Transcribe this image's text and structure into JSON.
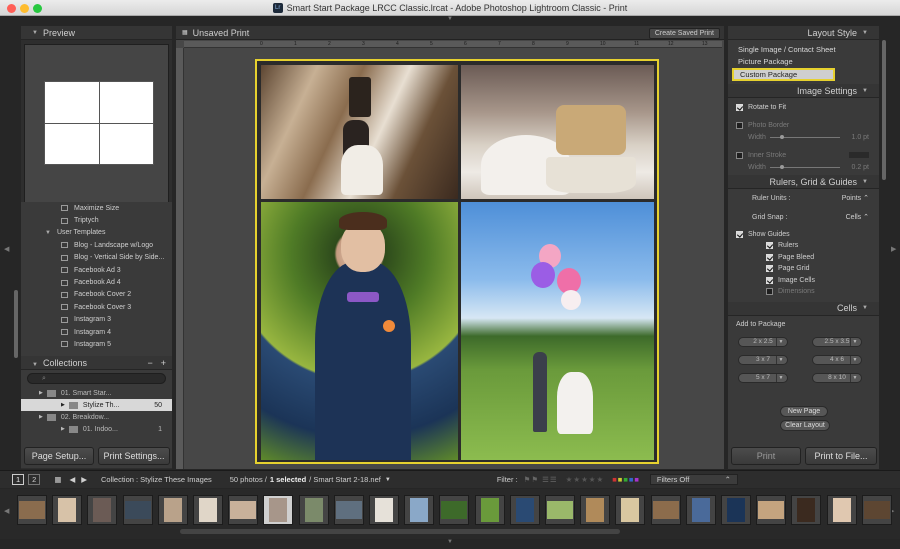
{
  "window": {
    "title": "Smart Start Package LRCC Classic.lrcat - Adobe Photoshop Lightroom Classic - Print",
    "app_badge": "Lr"
  },
  "left": {
    "preview_title": "Preview",
    "template_items": [
      {
        "label": "Maximize Size",
        "folder": false
      },
      {
        "label": "Triptych",
        "folder": false
      },
      {
        "label": "User Templates",
        "folder": true
      },
      {
        "label": "Blog - Landscape w/Logo",
        "folder": false
      },
      {
        "label": "Blog - Vertical Side by Side...",
        "folder": false
      },
      {
        "label": "Facebook Ad 3",
        "folder": false
      },
      {
        "label": "Facebook Ad 4",
        "folder": false
      },
      {
        "label": "Facebook Cover 2",
        "folder": false
      },
      {
        "label": "Facebook Cover 3",
        "folder": false
      },
      {
        "label": "Instagram 3",
        "folder": false
      },
      {
        "label": "Instagram 4",
        "folder": false
      },
      {
        "label": "Instagram 5",
        "folder": false
      }
    ],
    "collections_title": "Collections",
    "collections_minus": "−",
    "collections_plus": "+",
    "collections": [
      {
        "label": "01. Smart Star...",
        "count": "",
        "selected": false,
        "indent": 18
      },
      {
        "label": "Stylize Th...",
        "count": "50",
        "selected": true,
        "indent": 40
      },
      {
        "label": "02. Breakdow...",
        "count": "",
        "selected": false,
        "indent": 18
      },
      {
        "label": "01. Indoo...",
        "count": "1",
        "selected": false,
        "indent": 40
      }
    ],
    "page_setup": "Page Setup...",
    "print_settings": "Print Settings..."
  },
  "center": {
    "title": "Unsaved Print",
    "create_saved": "Create Saved Print",
    "ruler_ticks": [
      "0",
      "1",
      "2",
      "3",
      "4",
      "5",
      "6",
      "7",
      "8",
      "9",
      "10",
      "11",
      "12",
      "13",
      "14",
      "15",
      "16"
    ]
  },
  "right": {
    "layout_style": "Layout Style",
    "layout_options": [
      "Single Image / Contact Sheet",
      "Picture Package",
      "Custom Package"
    ],
    "image_settings": "Image Settings",
    "rotate_to_fit": "Rotate to Fit",
    "photo_border": "Photo Border",
    "width_label": "Width",
    "border_val": "1.0 pt",
    "inner_stroke": "Inner Stroke",
    "stroke_val": "0.2 pt",
    "rulers_title": "Rulers, Grid & Guides",
    "ruler_units_label": "Ruler Units :",
    "ruler_units_val": "Points",
    "grid_snap_label": "Grid Snap :",
    "grid_snap_val": "Cells",
    "show_guides": "Show Guides",
    "guides": [
      {
        "label": "Rulers",
        "on": true
      },
      {
        "label": "Page Bleed",
        "on": true
      },
      {
        "label": "Page Grid",
        "on": true
      },
      {
        "label": "Image Cells",
        "on": true
      },
      {
        "label": "Dimensions",
        "on": false
      }
    ],
    "cells_title": "Cells",
    "add_to_package": "Add to Package",
    "sizes": [
      "2 x 2.5",
      "2.5 x 3.5",
      "3 x 7",
      "4 x 6",
      "5 x 7",
      "8 x 10"
    ],
    "new_page": "New Page",
    "clear_layout": "Clear Layout",
    "print": "Print",
    "print_to_file": "Print to File..."
  },
  "bottom": {
    "page1": "1",
    "page2": "2",
    "collection_label": "Collection : Stylize These Images",
    "photos_count": "50 photos /",
    "selected": "1 selected",
    "file": "/ Smart Start 2-18.nef",
    "filter_label": "Filter :",
    "filters_off": "Filters Off"
  }
}
